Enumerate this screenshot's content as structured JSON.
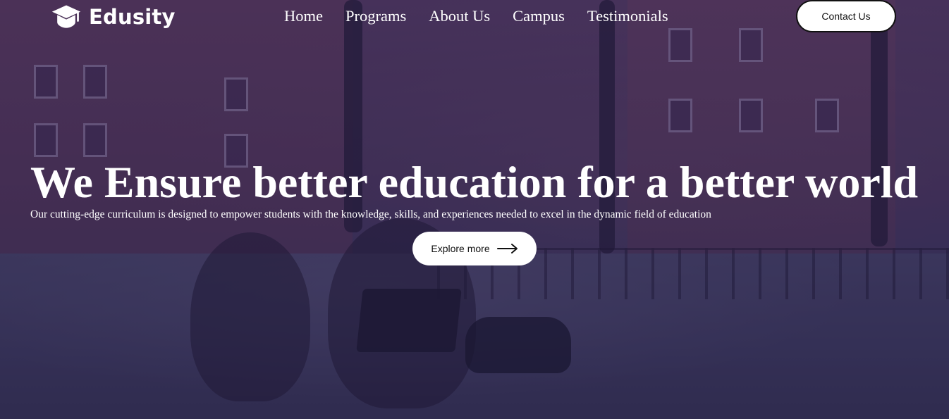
{
  "brand": {
    "name": "Edusity",
    "icon": "graduation-cap-icon"
  },
  "nav": {
    "items": [
      {
        "label": "Home"
      },
      {
        "label": "Programs"
      },
      {
        "label": "About Us"
      },
      {
        "label": "Campus"
      },
      {
        "label": "Testimonials"
      }
    ],
    "contact_label": "Contact Us"
  },
  "hero": {
    "title": "We Ensure better education for a better world",
    "subtitle": "Our cutting-edge curriculum is designed to empower students with the knowledge, skills, and experiences needed to excel in the dynamic field of education",
    "cta_label": "Explore more",
    "cta_icon": "arrow-right-icon"
  },
  "colors": {
    "overlay": "#282250",
    "button_bg": "#ffffff",
    "text_on_dark": "#ffffff",
    "text_on_light": "#111111"
  }
}
